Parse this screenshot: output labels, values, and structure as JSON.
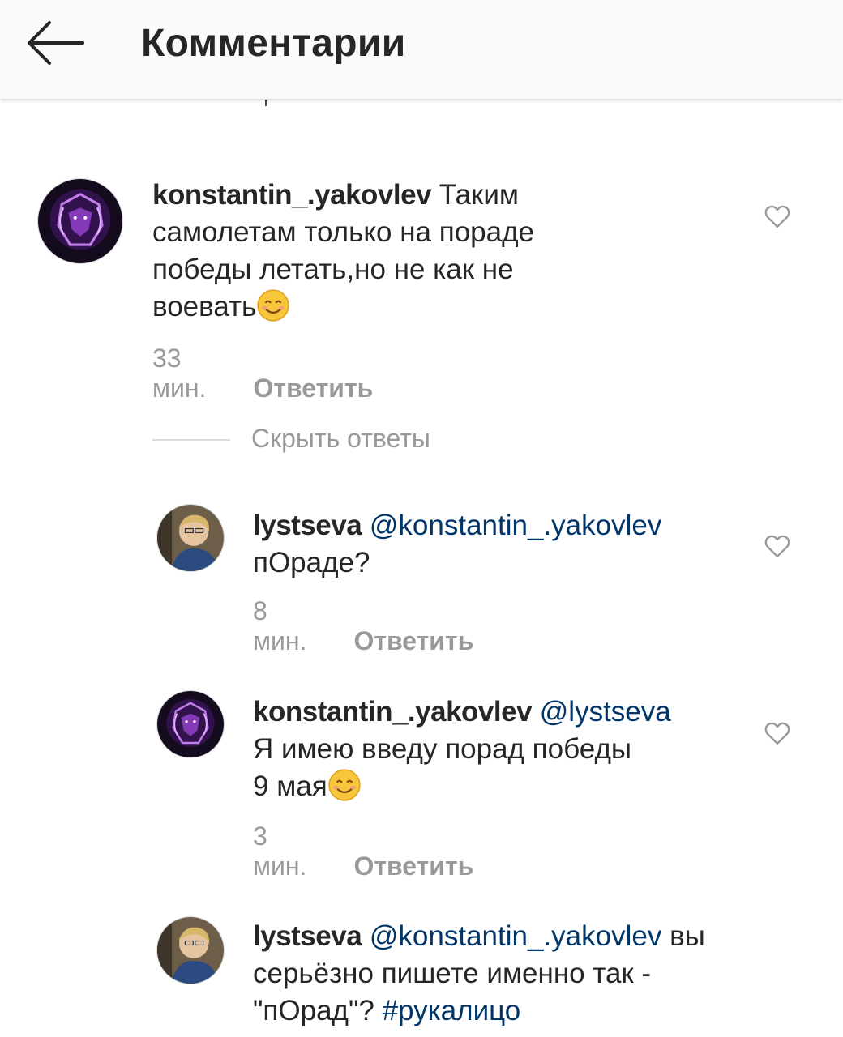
{
  "header": {
    "title": "Комментарии",
    "back_icon": "arrow-left-icon"
  },
  "comments": [
    {
      "username": "konstantin_.yakovlev",
      "text_line1": " Таким",
      "text_line2": "самолетам только на пораде",
      "text_line3": "победы летать,но не как не",
      "text_line4": "воевать",
      "emoji": "smiling-face-icon",
      "time": "33 мин.",
      "reply_label": "Ответить",
      "avatar": "lion-avatar"
    }
  ],
  "hide_replies_label": "Скрыть ответы",
  "replies": [
    {
      "username": "lystseva",
      "mention": "@konstantin_.yakovlev",
      "text_line2": "пОраде?",
      "time": "8 мин.",
      "reply_label": "Ответить",
      "avatar": "woman-avatar"
    },
    {
      "username": "konstantin_.yakovlev",
      "mention": "@lystseva",
      "text_line2": "Я имею введу порад победы",
      "text_line3": "9 мая",
      "emoji": "smiling-face-icon",
      "time": "3 мин.",
      "reply_label": "Ответить",
      "avatar": "lion-avatar"
    },
    {
      "username": "lystseva",
      "mention": "@konstantin_.yakovlev",
      "text_line1_tail": " вы",
      "text_line2": "серьёзно пишете именно так -",
      "text_line3": "\"пОрад\"? ",
      "hashtag": "#рукалицо",
      "avatar": "woman-avatar"
    }
  ],
  "colors": {
    "link": "#003569",
    "meta": "#999999",
    "text": "#262626",
    "topbar": "#fafafa"
  }
}
